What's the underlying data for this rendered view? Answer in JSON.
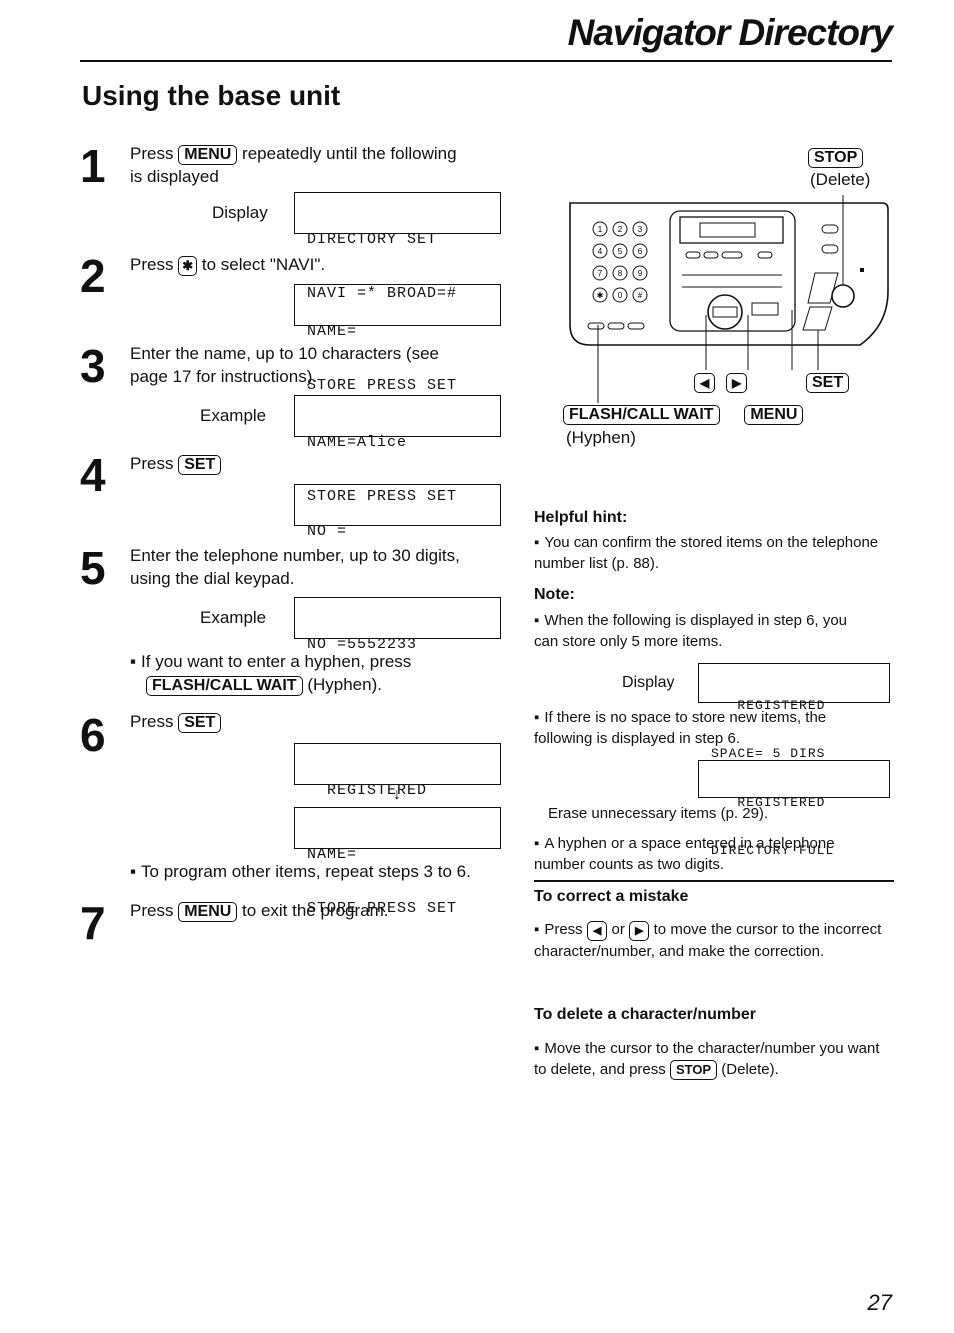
{
  "header": {
    "title": "Navigator Directory",
    "section": "Using the base unit"
  },
  "steps": {
    "s1": {
      "num": "1",
      "pre": "Press",
      "key": "MENU",
      "post": "repeatedly until the following",
      "line2": "is displayed",
      "display_label": "Display",
      "lcd": [
        "DIRECTORY SET",
        "NAVI =* BROAD=#"
      ]
    },
    "s2": {
      "num": "2",
      "pre": "Press",
      "key": "✱",
      "post": "to select \"NAVI\".",
      "lcd": [
        "NAME=",
        "STORE PRESS SET"
      ]
    },
    "s3": {
      "num": "3",
      "line1": "Enter the name, up to 10 characters (see",
      "line2": "page 17 for instructions).",
      "example_label": "Example",
      "lcd": [
        "NAME=Alice",
        "STORE PRESS SET"
      ]
    },
    "s4": {
      "num": "4",
      "pre": "Press",
      "key": "SET",
      "lcd": [
        "NO ="
      ]
    },
    "s5": {
      "num": "5",
      "line1": "Enter the telephone number, up to 30 digits,",
      "line2": "using the dial keypad.",
      "example_label": "Example",
      "lcd": [
        "NO =5552233"
      ],
      "bullet_pre": "If you want to enter a hyphen, press",
      "bullet_key": "FLASH/CALL WAIT",
      "bullet_post": "(Hyphen)."
    },
    "s6": {
      "num": "6",
      "pre": "Press",
      "key": "SET",
      "lcd1": [
        "  REGISTERED"
      ],
      "arrow": "↓",
      "lcd2": [
        "NAME=",
        "STORE PRESS SET"
      ],
      "bullet": "To program other items, repeat steps 3 to 6."
    },
    "s7": {
      "num": "7",
      "pre": "Press",
      "key": "MENU",
      "post": "to exit the program."
    }
  },
  "diagram": {
    "stop_key": "STOP",
    "stop_caption": "(Delete)",
    "flash_key": "FLASH/CALL WAIT",
    "menu_key": "MENU",
    "hyphen_caption": "(Hyphen)",
    "set_key": "SET",
    "left_arrow": "◀",
    "right_arrow": "▶",
    "keypad": [
      "1",
      "2",
      "3",
      "4",
      "5",
      "6",
      "7",
      "8",
      "9",
      "✱",
      "0",
      "#"
    ]
  },
  "right": {
    "helpful_hint": {
      "title": "Helpful hint:",
      "text": "You can confirm the stored items on the telephone number list (p. 88)."
    },
    "note": {
      "title": "Note:",
      "b1": "When the following is displayed in step 6, you can store only 5 more items.",
      "display_label": "Display",
      "lcd1": [
        "   REGISTERED",
        "SPACE= 5 DIRS"
      ],
      "b2": "If there is no space to store new items, the following is displayed in step 6.",
      "lcd2": [
        "   REGISTERED",
        "DIRECTORY FULL"
      ],
      "erase": "Erase unnecessary items (p. 29).",
      "b3": "A hyphen or a space entered in a telephone number counts as two digits."
    },
    "correct": {
      "title": "To correct a mistake",
      "pre": "Press",
      "k1": "◀",
      "mid": "or",
      "k2": "▶",
      "post": "to move the cursor to the incorrect character/number, and make the correction."
    },
    "delete": {
      "title": "To delete a character/number",
      "pre": "Move the cursor to the character/number you want to delete, and press",
      "key": "STOP",
      "post": "(Delete)."
    }
  },
  "footer": {
    "page_number": "27"
  }
}
